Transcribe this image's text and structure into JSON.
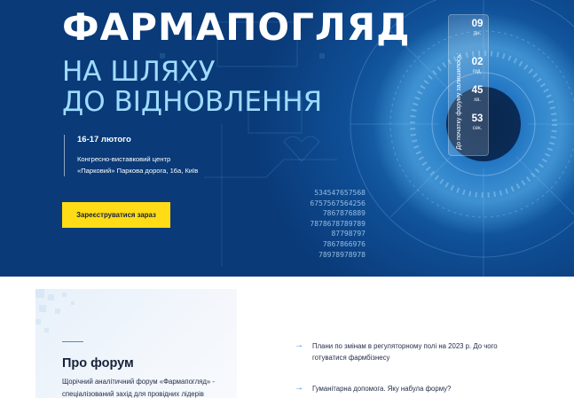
{
  "hero": {
    "title": "ФАРМАПОГЛЯД",
    "subtitle_line1": "НА ШЛЯХУ",
    "subtitle_line2": "ДО ВІДНОВЛЕННЯ",
    "date": "16-17 лютого",
    "venue_line1": "Конгресно-виставковий центр",
    "venue_line2": "«Парковий» Паркова дорога, 16а, Київ",
    "register_button": "Зареєструватися зараз",
    "decor_numbers": [
      "534547657568",
      "6757567564256",
      "7867876889",
      "7878678789789",
      "87798797",
      "7867866976",
      "78978978978"
    ]
  },
  "countdown": {
    "label": "До початку форуму залишилось:",
    "items": [
      {
        "value": "09",
        "unit": "дн."
      },
      {
        "value": "02",
        "unit": "год."
      },
      {
        "value": "45",
        "unit": "хв."
      },
      {
        "value": "53",
        "unit": "сек."
      }
    ]
  },
  "about": {
    "title": "Про форум",
    "text": "Щорічний аналітичний форум «Фармапогляд» - спеціалізований захід для провідних лідерів"
  },
  "topics": [
    "Плани по змінам в регуляторному полі на 2023 р. До чого готуватися фармбізнесу",
    "Гуманітарна допомога. Яку набула форму?"
  ],
  "colors": {
    "hero_blue": "#0e4c9a",
    "accent_yellow": "#ffdc16",
    "subtitle_cyan": "#9fdcff",
    "arrow_blue": "#2e86d6"
  }
}
